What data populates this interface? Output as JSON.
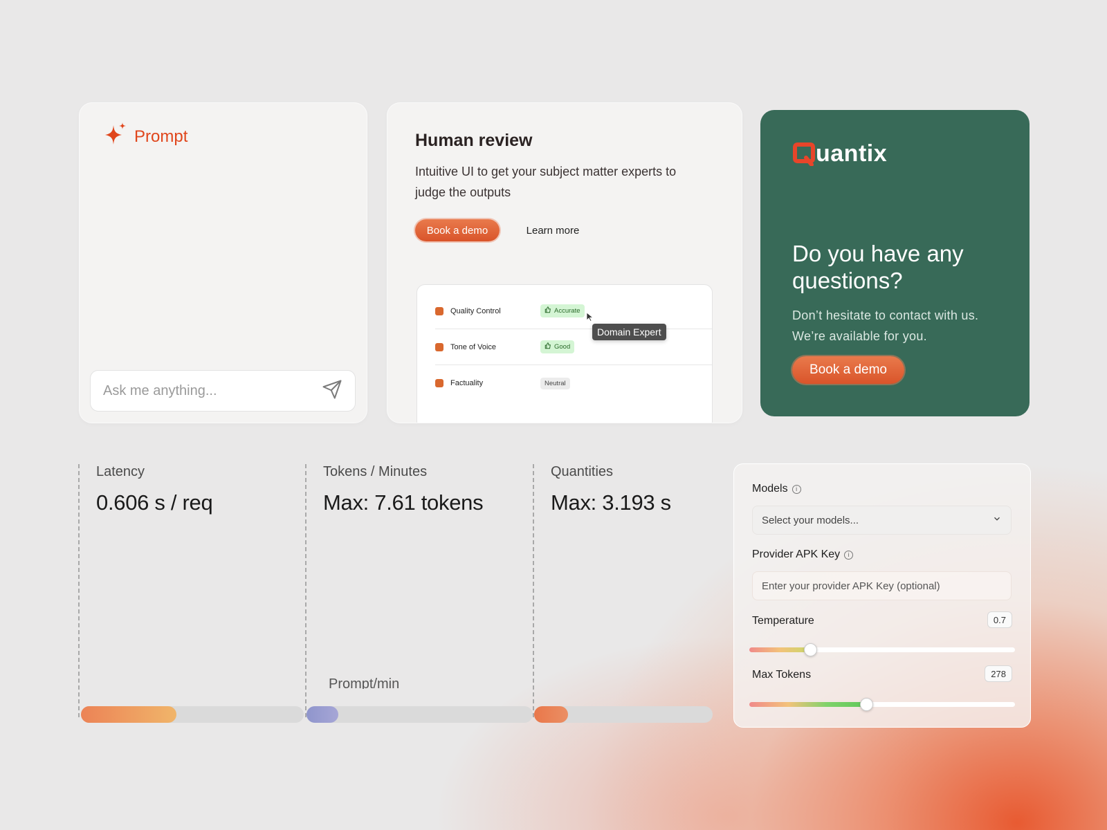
{
  "prompt_card": {
    "title": "Prompt",
    "input_placeholder": "Ask me anything..."
  },
  "review_card": {
    "title": "Human review",
    "description": "Intuitive UI to get your subject matter experts to judge the outputs",
    "primary_button": "Book a demo",
    "secondary_button": "Learn more",
    "rows": [
      {
        "label": "Quality Control",
        "tag": "Accurate",
        "tag_style": "green",
        "tag_icon": "thumbs-up-icon"
      },
      {
        "label": "Tone of Voice",
        "tag": "Good",
        "tag_style": "green",
        "tag_icon": "thumbs-up-icon"
      },
      {
        "label": "Factuality",
        "tag": "Neutral",
        "tag_style": "gray"
      }
    ],
    "tooltip": "Domain Expert"
  },
  "contact_card": {
    "logo_text": "uantix",
    "title": "Do you have any questions?",
    "description": "Don’t hesitate to contact with us. We’re available for you.",
    "button": "Book a demo",
    "background_color": "#386a58"
  },
  "metrics": [
    {
      "label": "Latency",
      "value": "0.606 s / req",
      "progress": 0.43
    },
    {
      "label": "Tokens / Minutes",
      "value": "Max: 7.61 tokens",
      "progress": 0.14,
      "sub_label": "Prompt/min"
    },
    {
      "label": "Quantities",
      "value": "Max: 3.193 s",
      "progress": 0.19
    }
  ],
  "settings": {
    "models_label": "Models",
    "models_placeholder": "Select your models...",
    "api_key_label": "Provider APK Key",
    "api_key_placeholder": "Enter your provider APK Key (optional)",
    "temperature_label": "Temperature",
    "temperature_value": "0.7",
    "temperature_fraction": 0.23,
    "max_tokens_label": "Max Tokens",
    "max_tokens_value": "278",
    "max_tokens_fraction": 0.44
  },
  "colors": {
    "accent": "#e0461c",
    "brand_green": "#386a58",
    "page_background": "#e9e8e8"
  }
}
